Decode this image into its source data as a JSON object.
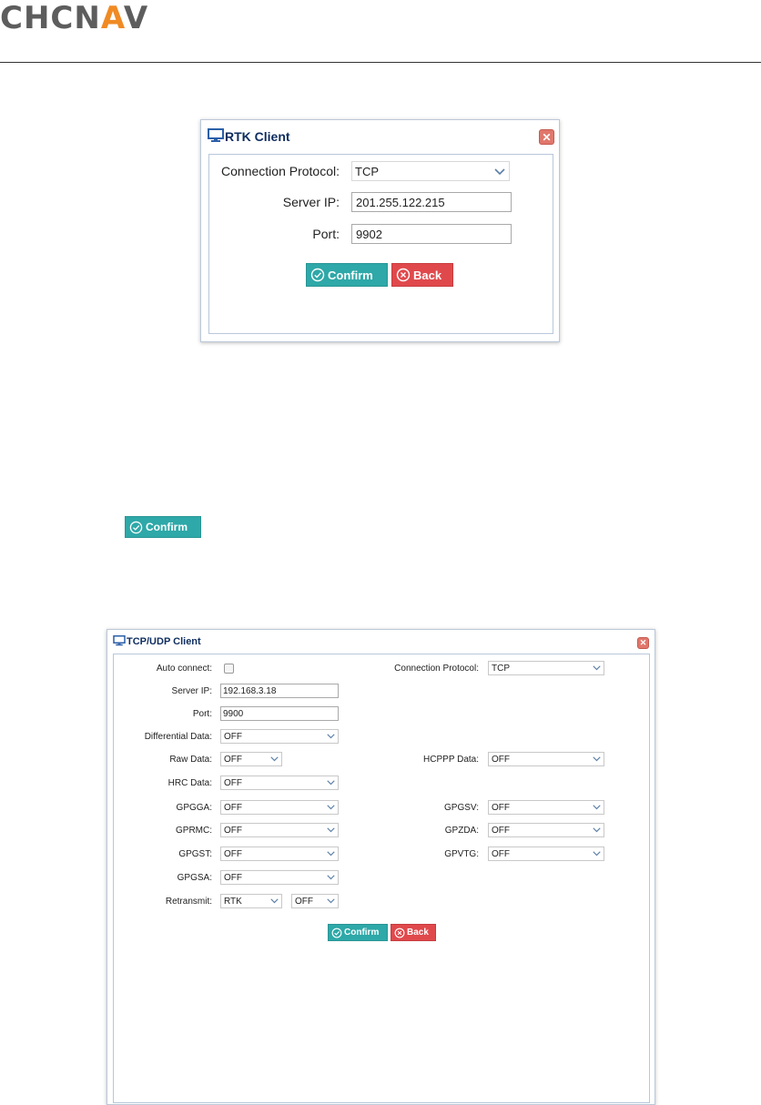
{
  "logo": {
    "part1": "CHCN",
    "part2": "A",
    "part3": "V"
  },
  "rtk_dialog": {
    "title": "RTK Client",
    "close_icon": "close-icon",
    "protocol_label": "Connection Protocol:",
    "protocol_value": "TCP",
    "server_ip_label": "Server IP:",
    "server_ip_value": "201.255.122.215",
    "port_label": "Port:",
    "port_value": "9902",
    "confirm_label": "Confirm",
    "back_label": "Back"
  },
  "inline_confirm": {
    "label": "Confirm"
  },
  "tcp_dialog": {
    "title": "TCP/UDP Client",
    "auto_connect_label": "Auto connect:",
    "protocol_label": "Connection Protocol:",
    "protocol_value": "TCP",
    "server_ip_label": "Server IP:",
    "server_ip_value": "192.168.3.18",
    "port_label": "Port:",
    "port_value": "9900",
    "differential_label": "Differential Data:",
    "differential_value": "OFF",
    "raw_label": "Raw Data:",
    "raw_value": "OFF",
    "hcppp_label": "HCPPP Data:",
    "hcppp_value": "OFF",
    "hrc_label": "HRC Data:",
    "hrc_value": "OFF",
    "gpgga_label": "GPGGA:",
    "gpgga_value": "OFF",
    "gpgsv_label": "GPGSV:",
    "gpgsv_value": "OFF",
    "gprmc_label": "GPRMC:",
    "gprmc_value": "OFF",
    "gpzda_label": "GPZDA:",
    "gpzda_value": "OFF",
    "gpgst_label": "GPGST:",
    "gpgst_value": "OFF",
    "gpvtg_label": "GPVTG:",
    "gpvtg_value": "OFF",
    "gpgsa_label": "GPGSA:",
    "gpgsa_value": "OFF",
    "retransmit_label": "Retransmit:",
    "retransmit_value1": "RTK",
    "retransmit_value2": "OFF",
    "confirm_label": "Confirm",
    "back_label": "Back"
  },
  "colors": {
    "logo_gray": "#5d5d5d",
    "logo_orange": "#f08a24",
    "confirm": "#2ea8a8",
    "back": "#e0494c",
    "title": "#0e2d5f"
  }
}
